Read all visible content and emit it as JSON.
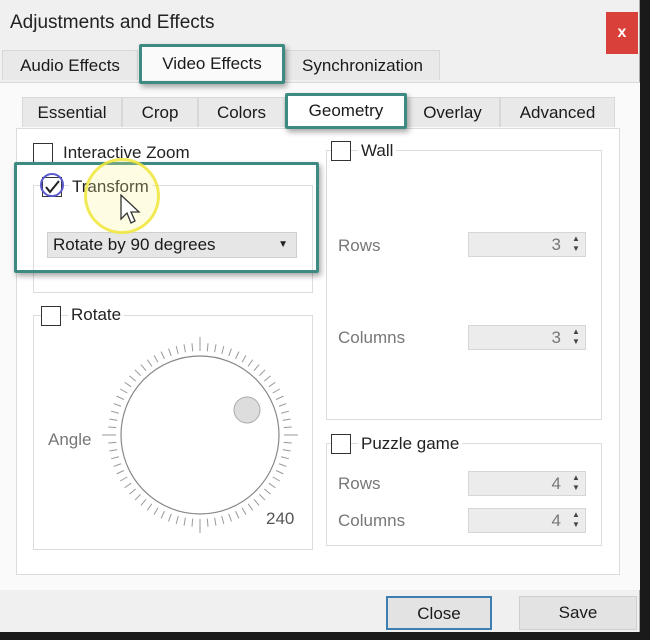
{
  "window": {
    "title": "Adjustments and Effects",
    "close_glyph": "x"
  },
  "main_tabs": [
    {
      "label": "Audio Effects"
    },
    {
      "label": "Video Effects",
      "selected": true
    },
    {
      "label": "Synchronization"
    }
  ],
  "sub_tabs": [
    {
      "label": "Essential"
    },
    {
      "label": "Crop"
    },
    {
      "label": "Colors"
    },
    {
      "label": "Geometry",
      "selected": true
    },
    {
      "label": "Overlay"
    },
    {
      "label": "Advanced"
    }
  ],
  "geometry": {
    "interactive_zoom": {
      "label": "Interactive Zoom",
      "checked": false
    },
    "transform": {
      "label": "Transform",
      "checked": true,
      "selected_option": "Rotate by 90 degrees"
    },
    "rotate": {
      "label": "Rotate",
      "checked": false,
      "angle_label": "Angle",
      "angle_value": "240"
    },
    "wall": {
      "label": "Wall",
      "checked": false,
      "rows_label": "Rows",
      "rows": "3",
      "columns_label": "Columns",
      "columns": "3"
    },
    "puzzle": {
      "label": "Puzzle game",
      "checked": false,
      "rows_label": "Rows",
      "rows": "4",
      "columns_label": "Columns",
      "columns": "4"
    }
  },
  "buttons": {
    "close": "Close",
    "save": "Save"
  },
  "colors": {
    "highlight": "#3d8a82",
    "close_button": "#d9403a"
  }
}
